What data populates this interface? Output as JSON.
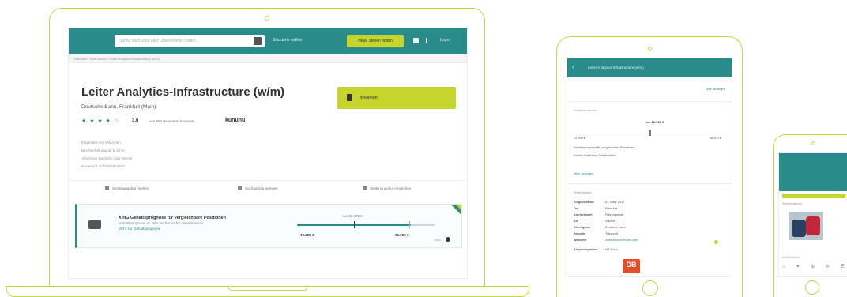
{
  "laptop": {
    "search_placeholder": "Suche nach Jobs oder Unternehmen finden...",
    "location_label": "Standorte wählen",
    "post_job_button": "Neue Stellen finden",
    "login_label": "Login",
    "breadcrumb": "Startseite  /  Jobs suchen  /  Leiter Analytics-Infrastructure (w/m)",
    "job_title": "Leiter Analytics-Infrastructure (w/m)",
    "company": "Deutsche Bahn, Frankfurt (Main)",
    "rating_stars": "★ ★ ★ ★ ☆",
    "rating_value": "3,6",
    "rating_source": "von 560 Bewertern bewertet",
    "rating_brand": "kununu",
    "meta": [
      "Eingestellt vor 3 Wochen",
      "Berufserfahrung ab 5 Jahre",
      "Abschluss Bachelor oder Master",
      "Basierend auf Gehaltsdaten"
    ],
    "apply_button": "Bewerben",
    "actions": [
      "Stellenangebot merken",
      "Suchauftrag anlegen",
      "Stellenangebot empfehlen"
    ],
    "salary": {
      "title": "XING Gehaltsprognose für vergleichbare Positionen",
      "subtitle": "Gehaltsprognose im Jahr mit Bonus für diese Position",
      "link": "Mehr zur Gehaltsprognose",
      "value": "ca. 82.000 €",
      "min": "72.000 €",
      "max": "96.000 €",
      "info": "Infos"
    }
  },
  "tablet": {
    "title": "Leiter Analytics-Infrastructure (w/m)",
    "link": "Alle anzeigen",
    "salary_label": "Gehaltsprognose",
    "salary_value": "ca. 82.000 €",
    "min": "72.000 €",
    "max": "96.000 €",
    "note1": "Gehaltsprognose für vergleichbare Positionen",
    "note2": "Gehalt basiert auf Gehaltsdaten",
    "more_link": "Mehr anzeigen",
    "details_label": "Stellendetails",
    "details": [
      [
        "Eingestellt am",
        "01. März 2017"
      ],
      [
        "Ort",
        "Frankfurt"
      ],
      [
        "Karrierestufe",
        "Führungskraft"
      ],
      [
        "Art",
        "Vollzeit"
      ],
      [
        "Arbeitgeber",
        "Deutsche Bahn"
      ],
      [
        "Branche",
        "Transport"
      ],
      [
        "Webseite",
        "www.deutschebahn.com"
      ],
      [
        "Ansprechpartner",
        "HR Team"
      ]
    ],
    "logo_text": "DB"
  },
  "phone": {
    "label1": "Stellenangebote",
    "label2": "Mehr erfahren",
    "nav": "⌂ ✦ ⊕ ✉ ☰"
  },
  "colors": {
    "teal": "#2a8b8b",
    "lime": "#c5d52b",
    "frame": "#c8d64a",
    "db_red": "#e34d2c"
  }
}
